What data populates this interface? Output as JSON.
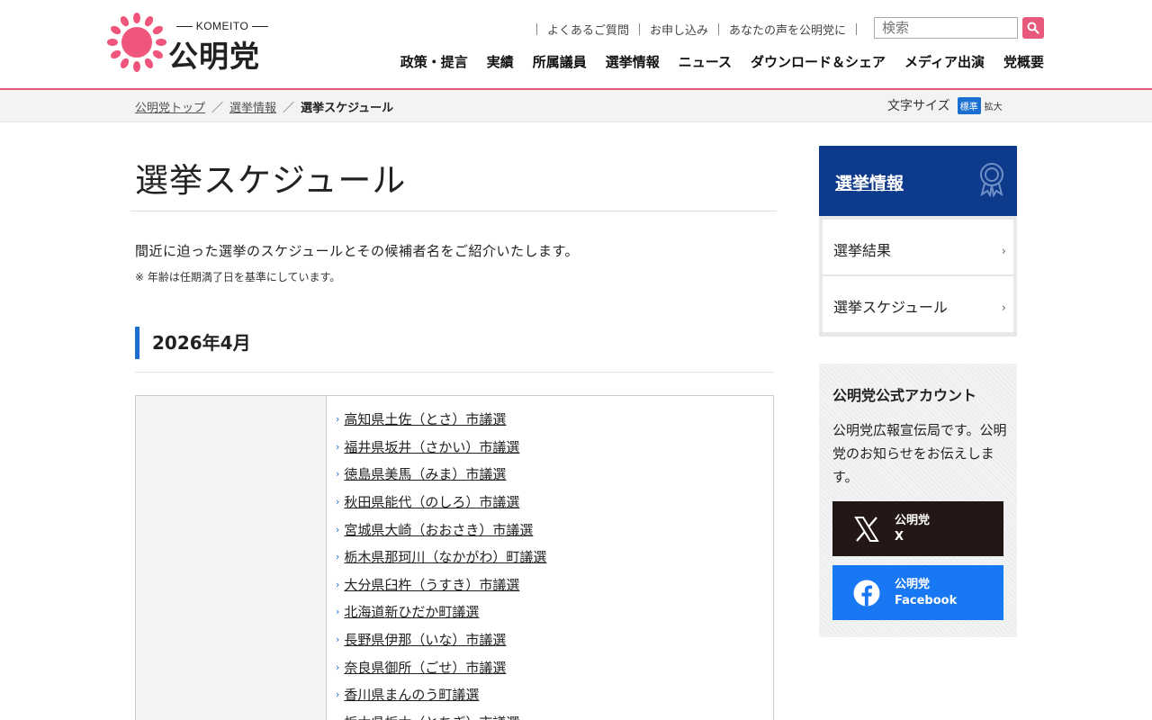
{
  "header": {
    "logo": {
      "brand_en": "KOMEITO",
      "brand_jp": "公明党",
      "color": "#f0567b"
    },
    "util_links": [
      "よくあるご質問",
      "お申し込み",
      "あなたの声を公明党に"
    ],
    "search": {
      "placeholder": "検索",
      "icon": "search-icon"
    },
    "nav": [
      "政策・提言",
      "実績",
      "所属議員",
      "選挙情報",
      "ニュース",
      "ダウンロード＆シェア",
      "メディア出演",
      "党概要"
    ]
  },
  "breadcrumb": {
    "items": [
      "公明党トップ",
      "選挙情報"
    ],
    "current": "選挙スケジュール"
  },
  "font_size": {
    "label": "文字サイズ",
    "standard": "標準",
    "large": "拡大"
  },
  "main": {
    "title": "選挙スケジュール",
    "intro": "間近に迫った選挙のスケジュールとその候補者名をご紹介いたします。",
    "note": "※ 年齢は任期満了日を基準にしています。",
    "month": "2026年4月",
    "elections": [
      "高知県土佐（とさ）市議選",
      "福井県坂井（さかい）市議選",
      "徳島県美馬（みま）市議選",
      "秋田県能代（のしろ）市議選",
      "宮城県大崎（おおさき）市議選",
      "栃木県那珂川（なかがわ）町議選",
      "大分県臼杵（うすき）市議選",
      "北海道新ひだか町議選",
      "長野県伊那（いな）市議選",
      "奈良県御所（ごせ）市議選",
      "香川県まんのう町議選",
      "栃木県栃木（とちぎ）市議選"
    ]
  },
  "sidebar": {
    "section_title": "選挙情報",
    "items": [
      "選挙結果",
      "選挙スケジュール"
    ],
    "accounts": {
      "title": "公明党公式アカウント",
      "description": "公明党広報宣伝局です。公明党のお知らせをお伝えします。",
      "x": {
        "name": "公明党",
        "service": "X"
      },
      "facebook": {
        "name": "公明党",
        "service": "Facebook"
      }
    }
  },
  "colors": {
    "accent_pink": "#e8587a",
    "nav_blue": "#0d3a8a",
    "bar_blue": "#1a6fd0",
    "facebook_blue": "#1877f2",
    "x_black": "#231815"
  }
}
